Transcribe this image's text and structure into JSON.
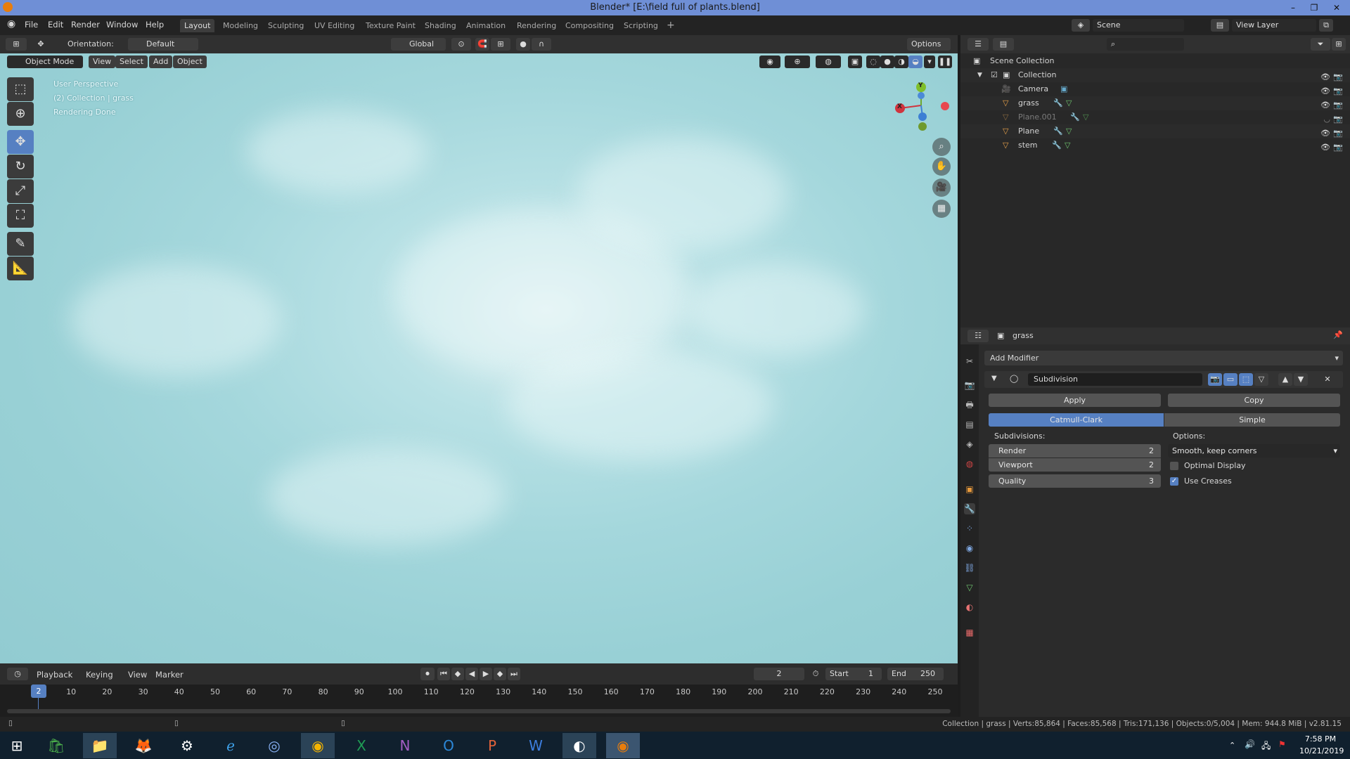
{
  "window": {
    "title": "Blender* [E:\\field full of plants.blend]",
    "min": "–",
    "max": "❐",
    "close": "✕"
  },
  "menu": [
    "File",
    "Edit",
    "Render",
    "Window",
    "Help"
  ],
  "workspaces": [
    "Layout",
    "Modeling",
    "Sculpting",
    "UV Editing",
    "Texture Paint",
    "Shading",
    "Animation",
    "Rendering",
    "Compositing",
    "Scripting"
  ],
  "scene": {
    "label": "Scene",
    "view_layer": "View Layer"
  },
  "vp_header": {
    "orientation_label": "Orientation:",
    "orientation_value": "Default",
    "transform": "Global",
    "options": "Options"
  },
  "vp_header2": {
    "mode": "Object Mode",
    "view": "View",
    "select": "Select",
    "add": "Add",
    "object": "Object"
  },
  "viewport_info": {
    "line1": "User Perspective",
    "line2": "(2) Collection | grass",
    "line3": "Rendering Done"
  },
  "gizmo": {
    "x": "X",
    "y": "Y",
    "z": "Z"
  },
  "outliner": {
    "search_placeholder": "",
    "scene_collection": "Scene Collection",
    "collection": "Collection",
    "items": [
      {
        "name": "Camera"
      },
      {
        "name": "grass"
      },
      {
        "name": "Plane.001"
      },
      {
        "name": "Plane"
      },
      {
        "name": "stem"
      }
    ]
  },
  "properties": {
    "object_name": "grass",
    "add_modifier": "Add Modifier",
    "modifier_name": "Subdivision",
    "apply": "Apply",
    "copy": "Copy",
    "catmull": "Catmull-Clark",
    "simple": "Simple",
    "subdivisions_label": "Subdivisions:",
    "options_label": "Options:",
    "render_label": "Render",
    "render_value": "2",
    "viewport_label": "Viewport",
    "viewport_value": "2",
    "quality_label": "Quality",
    "quality_value": "3",
    "uv_mode": "Smooth, keep corners",
    "optimal_display": "Optimal Display",
    "optimal_display_checked": false,
    "use_creases": "Use Creases",
    "use_creases_checked": true
  },
  "timeline": {
    "playback": "Playback",
    "keying": "Keying",
    "view": "View",
    "marker": "Marker",
    "current_frame": "2",
    "start_label": "Start",
    "start": "1",
    "end_label": "End",
    "end": "250",
    "ticks": [
      "10",
      "20",
      "30",
      "40",
      "50",
      "60",
      "70",
      "80",
      "90",
      "100",
      "110",
      "120",
      "130",
      "140",
      "150",
      "160",
      "170",
      "180",
      "190",
      "200",
      "210",
      "220",
      "230",
      "240",
      "250"
    ],
    "cursor": "2"
  },
  "status": "Collection | grass | Verts:85,864 | Faces:85,568 | Tris:171,136 | Objects:0/5,004 | Mem: 944.8 MiB | v2.81.15",
  "taskbar": {
    "time": "7:58 PM",
    "date": "10/21/2019"
  },
  "colors": {
    "accent": "#5680c2",
    "titlebar": "#6f8fd6",
    "viewport_sky": "#98d0d5"
  }
}
